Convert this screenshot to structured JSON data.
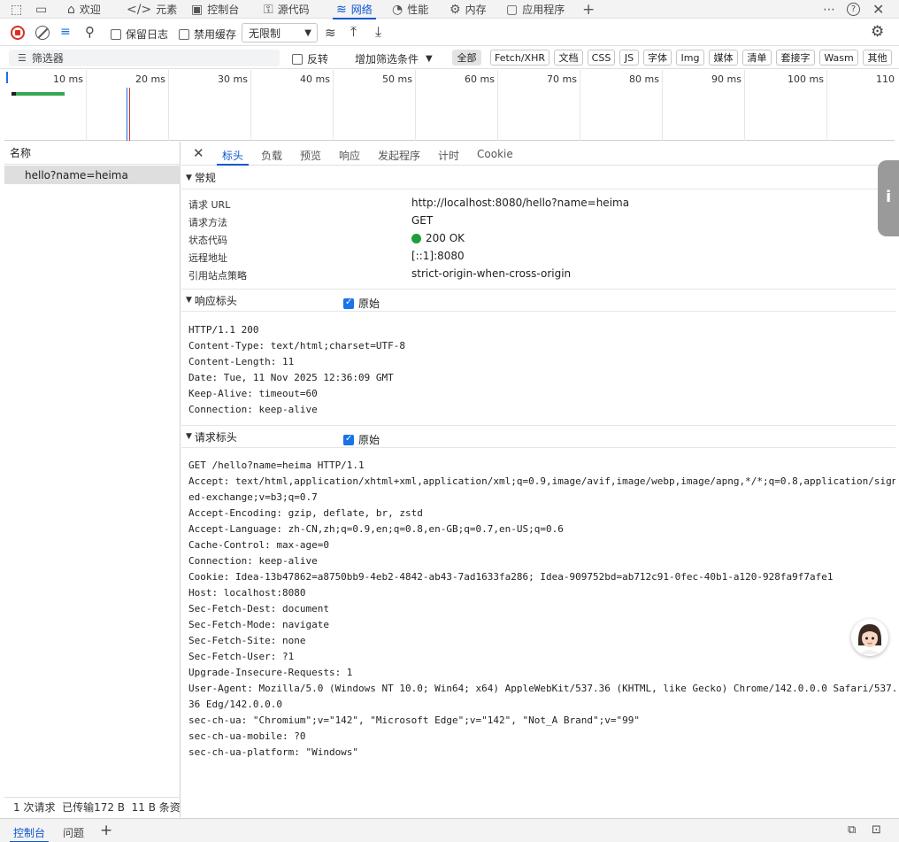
{
  "tabs": [
    {
      "label": "",
      "icon": "inspect-icon"
    },
    {
      "label": "",
      "icon": "device-icon"
    },
    {
      "label": "欢迎",
      "icon": "home-icon"
    },
    {
      "label": "元素",
      "icon": "code-icon"
    },
    {
      "label": "控制台",
      "icon": "console-icon"
    },
    {
      "label": "源代码",
      "icon": "sources-icon"
    },
    {
      "label": "网络",
      "icon": "wifi-icon"
    },
    {
      "label": "性能",
      "icon": "performance-icon"
    },
    {
      "label": "内存",
      "icon": "memory-icon"
    },
    {
      "label": "应用程序",
      "icon": "application-icon"
    }
  ],
  "toolbar": {
    "preserve_log": "保留日志",
    "disable_cache": "禁用缓存",
    "throttle": "无限制"
  },
  "filter": {
    "placeholder": "筛选器",
    "invert": "反转",
    "more_filters": "增加筛选条件",
    "types": [
      "全部",
      "Fetch/XHR",
      "文档",
      "CSS",
      "JS",
      "字体",
      "Img",
      "媒体",
      "清单",
      "套接字",
      "Wasm",
      "其他"
    ]
  },
  "timeline": {
    "ticks": [
      "10 ms",
      "20 ms",
      "30 ms",
      "40 ms",
      "50 ms",
      "60 ms",
      "70 ms",
      "80 ms",
      "90 ms",
      "100 ms",
      "110"
    ]
  },
  "requests": {
    "header": "名称",
    "items": [
      "hello?name=heima"
    ],
    "footer": "1 次请求  已传输172 B  11 B 条资"
  },
  "detail_tabs": [
    "标头",
    "负载",
    "预览",
    "响应",
    "发起程序",
    "计时",
    "Cookie"
  ],
  "general": {
    "title": "常规",
    "rows": [
      {
        "key": "请求 URL",
        "value": "http://localhost:8080/hello?name=heima"
      },
      {
        "key": "请求方法",
        "value": "GET"
      },
      {
        "key": "状态代码",
        "value": "200 OK"
      },
      {
        "key": "远程地址",
        "value": "[::1]:8080"
      },
      {
        "key": "引用站点策略",
        "value": "strict-origin-when-cross-origin"
      }
    ],
    "status_color": "#1e9e3b"
  },
  "response_headers": {
    "title": "响应标头",
    "raw_label": "原始",
    "lines": [
      "HTTP/1.1 200",
      "Content-Type: text/html;charset=UTF-8",
      "Content-Length: 11",
      "Date: Tue, 11 Nov 2025 12:36:09 GMT",
      "Keep-Alive: timeout=60",
      "Connection: keep-alive"
    ]
  },
  "request_headers": {
    "title": "请求标头",
    "raw_label": "原始",
    "lines": [
      "GET /hello?name=heima HTTP/1.1",
      "Accept: text/html,application/xhtml+xml,application/xml;q=0.9,image/avif,image/webp,image/apng,*/*;q=0.8,application/sign",
      "ed-exchange;v=b3;q=0.7",
      "Accept-Encoding: gzip, deflate, br, zstd",
      "Accept-Language: zh-CN,zh;q=0.9,en;q=0.8,en-GB;q=0.7,en-US;q=0.6",
      "Cache-Control: max-age=0",
      "Connection: keep-alive",
      "Cookie: Idea-13b47862=a8750bb9-4eb2-4842-ab43-7ad1633fa286; Idea-909752bd=ab712c91-0fec-40b1-a120-928fa9f7afe1",
      "Host: localhost:8080",
      "Sec-Fetch-Dest: document",
      "Sec-Fetch-Mode: navigate",
      "Sec-Fetch-Site: none",
      "Sec-Fetch-User: ?1",
      "Upgrade-Insecure-Requests: 1",
      "User-Agent: Mozilla/5.0 (Windows NT 10.0; Win64; x64) AppleWebKit/537.36 (KHTML, like Gecko) Chrome/142.0.0.0 Safari/537.",
      "36 Edg/142.0.0.0",
      "sec-ch-ua: \"Chromium\";v=\"142\", \"Microsoft Edge\";v=\"142\", \"Not_A Brand\";v=\"99\"",
      "sec-ch-ua-mobile: ?0",
      "sec-ch-ua-platform: \"Windows\""
    ]
  },
  "bottom_tabs": [
    "控制台",
    "问题"
  ],
  "accent": "#0b57d0"
}
